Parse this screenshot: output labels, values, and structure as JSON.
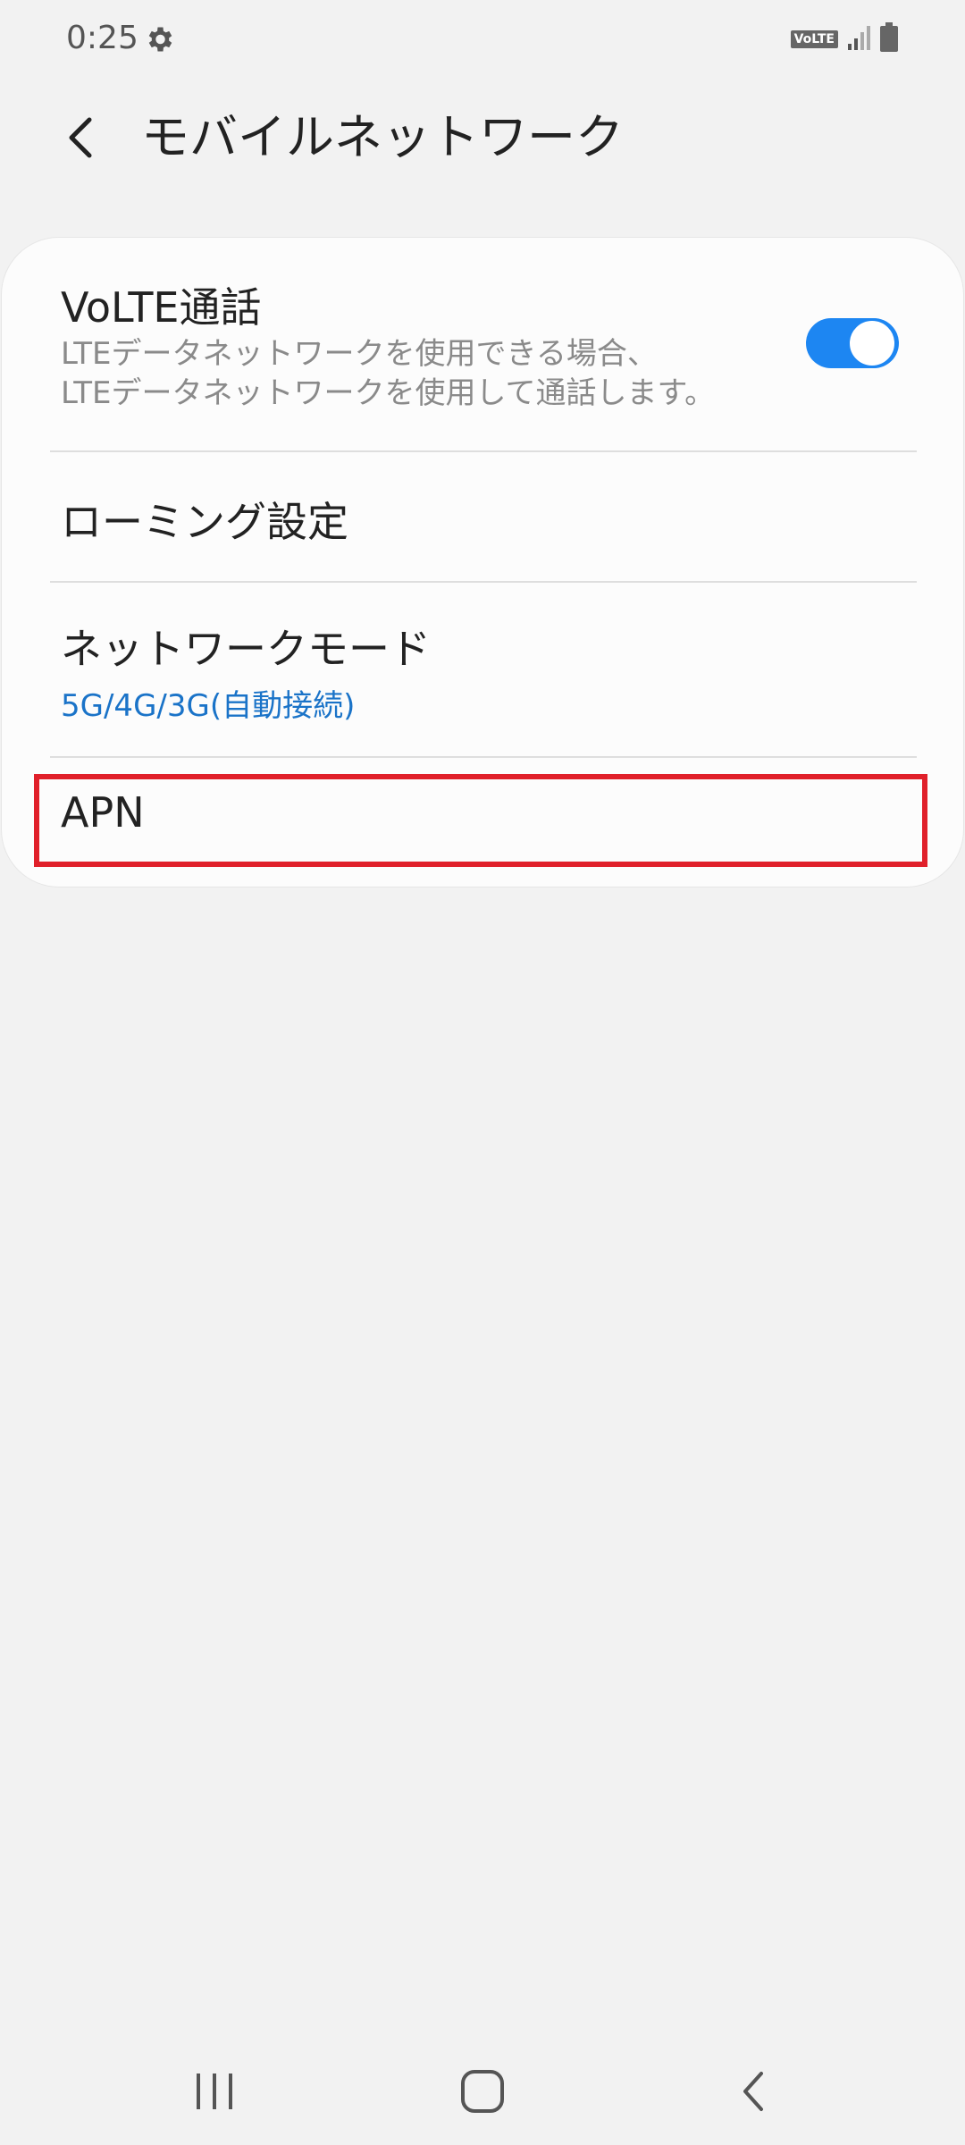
{
  "status": {
    "time": "0:25",
    "volte_badge": "VoLTE"
  },
  "header": {
    "title": "モバイルネットワーク"
  },
  "settings": {
    "volte": {
      "title": "VoLTE通話",
      "summary": "LTEデータネットワークを使用できる場合、\nLTEデータネットワークを使用して通話します。",
      "enabled": true
    },
    "roaming": {
      "title": "ローミング設定"
    },
    "network_mode": {
      "title": "ネットワークモード",
      "value": "5G/4G/3G(自動接続)"
    },
    "apn": {
      "title": "APN"
    }
  },
  "colors": {
    "accent": "#1d86f2",
    "highlight": "#e0202a",
    "background": "#f2f2f2"
  },
  "icons": {
    "status_left": "gear-icon",
    "status_right": [
      "volte-icon",
      "signal-icon",
      "battery-icon"
    ],
    "header": "back-arrow-icon",
    "nav": [
      "recents-icon",
      "home-icon",
      "back-icon"
    ]
  }
}
